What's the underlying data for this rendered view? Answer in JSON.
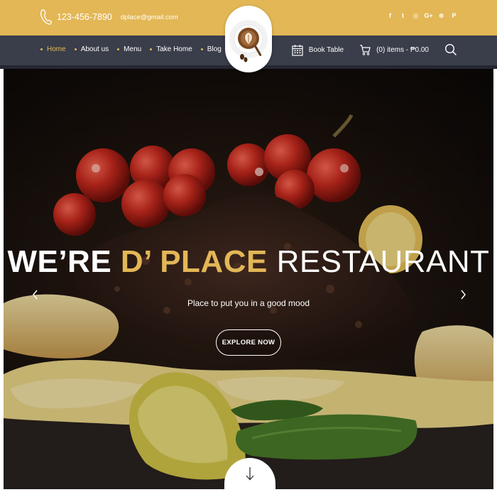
{
  "colors": {
    "accent": "#e3b756",
    "nav_bg": "#3a3d4a",
    "white": "#ffffff"
  },
  "topbar": {
    "phone_icon": "phone-icon",
    "phone": "123-456-7890",
    "email": "dplace@gmail.com",
    "socials": [
      {
        "name": "facebook-icon",
        "glyph": "f"
      },
      {
        "name": "twitter-icon",
        "glyph": "t"
      },
      {
        "name": "instagram-icon",
        "glyph": "◎"
      },
      {
        "name": "google-plus-icon",
        "glyph": "G+"
      },
      {
        "name": "dribbble-icon",
        "glyph": "⊕"
      },
      {
        "name": "pinterest-icon",
        "glyph": "P"
      }
    ]
  },
  "nav": {
    "items": [
      {
        "label": "Home",
        "active": true
      },
      {
        "label": "About us",
        "active": false
      },
      {
        "label": "Menu",
        "active": false
      },
      {
        "label": "Take Home",
        "active": false
      },
      {
        "label": "Blog",
        "active": false
      }
    ],
    "book_table": "Book Table",
    "cart": "(0) items - ₱0.00"
  },
  "logo": {
    "icon": "coffee-cup-logo"
  },
  "hero": {
    "title_part1": "WE’RE",
    "title_part2": "D’ PLACE",
    "title_part3": "RESTAURANT",
    "subtitle": "Place to put you in a good mood",
    "button": "EXPLORE NOW"
  }
}
